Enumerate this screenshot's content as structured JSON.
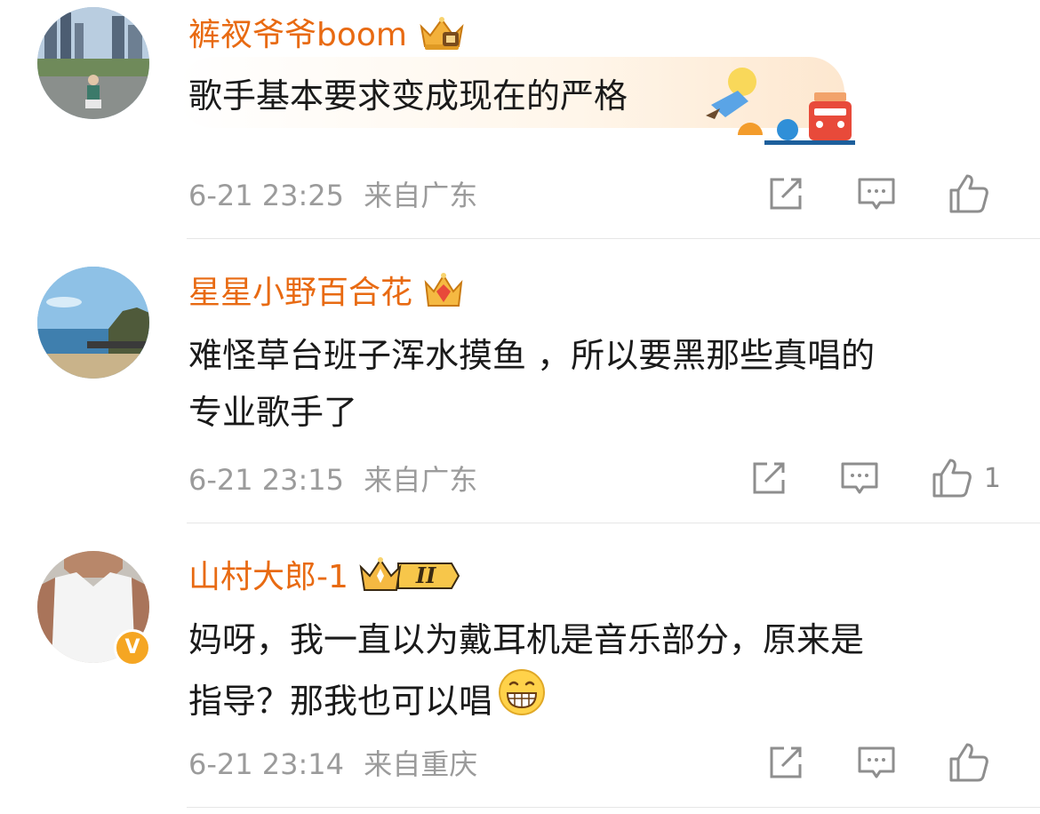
{
  "comments": [
    {
      "username": "裤衩爷爷boom",
      "badge": "crown-badge-icon",
      "text": "歌手基本要求变成现在的严格",
      "timestamp": "6-21 23:25",
      "location": "来自广东",
      "like_count": ""
    },
    {
      "username": "星星小野百合花",
      "badge": "crown-gem-badge-icon",
      "text_line1": "难怪草台班子浑水摸鱼 ，所以要黑那些真唱的",
      "text_line2": "专业歌手了",
      "timestamp": "6-21 23:15",
      "location": "来自广东",
      "like_count": "1"
    },
    {
      "username": "山村大郎-1",
      "badge": "crown-level-badge-icon",
      "badge_level": "II",
      "verified_mark": "V",
      "text_line1": "妈呀，我一直以为戴耳机是音乐部分，原来是",
      "text_line2": "指导？那我也可以唱",
      "timestamp": "6-21 23:14",
      "location": "来自重庆",
      "like_count": ""
    }
  ],
  "colors": {
    "username": "#e86a12",
    "text": "#1a1a1a",
    "meta": "#9b9b9b",
    "divider": "#e6e6e6"
  }
}
